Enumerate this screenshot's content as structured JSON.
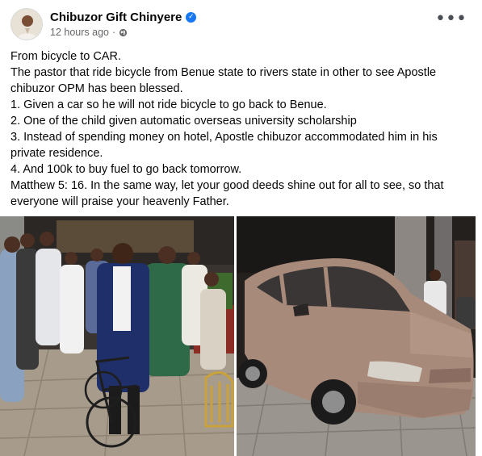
{
  "post": {
    "author": "Chibuzor Gift Chinyere",
    "timestamp": "12 hours ago",
    "separator": "·",
    "more_label": "•••",
    "privacy_icon": "globe-icon",
    "verified_icon": "verified-badge-icon",
    "lines": [
      "From bicycle to CAR.",
      "The pastor that ride bicycle from Benue state to rivers state in other to see Apostle chibuzor OPM has been blessed.",
      "1. Given a car so he will not ride bicycle to go back to Benue.",
      "2. One of the child given automatic overseas university scholarship",
      "3. Instead of spending money on hotel, Apostle chibuzor accommodated him in his private residence.",
      "4. And 100k to buy fuel to go back tomorrow.",
      "Matthew 5: 16. In the same way, let your good deeds shine out for all to see, so that everyone will praise your heavenly Father."
    ]
  },
  "colors": {
    "verified": "#1877f2",
    "meta_text": "#65676b",
    "car_body": "#a88a7a"
  }
}
